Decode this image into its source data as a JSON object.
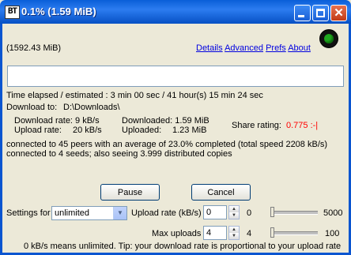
{
  "window": {
    "logo": "BT",
    "title": "0.1% (1.59 MiB)"
  },
  "header": {
    "size": "(1592.43 MiB)",
    "links": {
      "details": "Details",
      "advanced": "Advanced",
      "prefs": "Prefs",
      "about": "About"
    },
    "status_color": "#1fa81f"
  },
  "progress": {
    "fraction": 0.001
  },
  "info": {
    "time_elapsed": "Time elapsed / estimated : 3 min 00 sec / 41 hour(s) 15 min 24 sec",
    "download_to_label": "Download to:",
    "download_to_path": "D:\\Downloads\\",
    "download_rate": "Download rate: 9 kB/s",
    "upload_rate_label": "Upload rate:",
    "upload_rate_value": "20 kB/s",
    "downloaded": "Downloaded: 1.59 MiB",
    "uploaded_label": "Uploaded:",
    "uploaded_value": "1.23 MiB",
    "share_label": "Share rating:",
    "share_value": "0.775 :-|",
    "peers": "connected to 45 peers with an average of 23.0% completed (total speed 2208 kB/s)",
    "seeds": "connected to 4 seeds; also seeing 3.999 distributed copies"
  },
  "buttons": {
    "pause": "Pause",
    "cancel": "Cancel"
  },
  "settings": {
    "label": "Settings for",
    "selected": "unlimited",
    "upload_rate_label": "Upload rate (kB/s)",
    "upload_rate_value": "0",
    "upload_slider_min": "0",
    "upload_slider_max": "5000",
    "upload_slider_value": 0,
    "max_uploads_label": "Max uploads",
    "max_uploads_value": "4",
    "max_uploads_min": "4",
    "max_uploads_max": "100",
    "max_uploads_slider_value": 4
  },
  "footer": {
    "tip": "0 kB/s means unlimited. Tip: your download rate is proportional to your upload rate"
  }
}
